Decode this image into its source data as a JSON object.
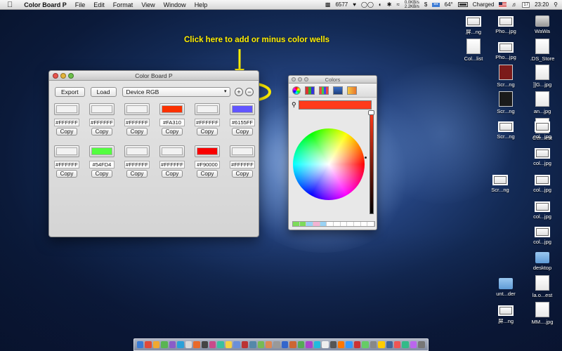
{
  "menubar": {
    "apple": "",
    "app_name": "Color Board P",
    "menus": [
      "File",
      "Edit",
      "Format",
      "View",
      "Window",
      "Help"
    ],
    "status": {
      "count": "6577",
      "network_up": "0.0KB/s",
      "network_down": "2.2KB/s",
      "temperature": "64°",
      "battery": "Charged",
      "calendar_day": "17",
      "time": "23:20"
    }
  },
  "annotation": {
    "text": "Click here to add or minus color wells",
    "color": "#FFEE00"
  },
  "color_board": {
    "title": "Color Board P",
    "export_label": "Export",
    "load_label": "Load",
    "colorspace": "Device RGB",
    "add_label": "+",
    "minus_label": "−",
    "wells_row1": [
      {
        "hex": "#FFFFFF",
        "color": "#F2F2F2",
        "copy": "Copy"
      },
      {
        "hex": "#FFFFFF",
        "color": "#F2F2F2",
        "copy": "Copy"
      },
      {
        "hex": "#FFFFFF",
        "color": "#F2F2F2",
        "copy": "Copy"
      },
      {
        "hex": "#FA310",
        "color": "#FA3100",
        "copy": "Copy"
      },
      {
        "hex": "#FFFFFF",
        "color": "#F2F2F2",
        "copy": "Copy"
      },
      {
        "hex": "#6155FF",
        "color": "#6155FF",
        "copy": "Copy"
      }
    ],
    "wells_row2": [
      {
        "hex": "#FFFFFF",
        "color": "#F2F2F2",
        "copy": "Copy"
      },
      {
        "hex": "#54FD4",
        "color": "#54FD40",
        "copy": "Copy"
      },
      {
        "hex": "#FFFFFF",
        "color": "#F2F2F2",
        "copy": "Copy"
      },
      {
        "hex": "#FFFFFF",
        "color": "#F2F2F2",
        "copy": "Copy"
      },
      {
        "hex": "#F90000",
        "color": "#F90000",
        "copy": "Copy"
      },
      {
        "hex": "#FFFFFF",
        "color": "#F2F2F2",
        "copy": "Copy"
      }
    ]
  },
  "colors_panel": {
    "title": "Colors",
    "current_color": "#FF3A1A",
    "mode_icons": [
      "color-wheel-icon",
      "color-sliders-icon",
      "color-palettes-icon",
      "image-palettes-icon",
      "crayons-icon"
    ]
  },
  "desktop_icons": [
    {
      "label": "屏...ng"
    },
    {
      "label": "Pho...jpg"
    },
    {
      "label": "WaWa"
    },
    {
      "label": "Col...list"
    },
    {
      "label": "Pho...jpg"
    },
    {
      "label": ".DS_Store"
    },
    {
      "label": "Scr...ng"
    },
    {
      "label": "]]G...jpg"
    },
    {
      "label": "Scr...ng"
    },
    {
      "label": "an...jpg"
    },
    {
      "label": "Scr...ng"
    },
    {
      "label": "Cer...est"
    },
    {
      "label": "col...jpg"
    },
    {
      "label": "col...jpg"
    },
    {
      "label": "Scr...ng"
    },
    {
      "label": "col...jpg"
    },
    {
      "label": "col...jpg"
    },
    {
      "label": "col...jpg"
    },
    {
      "label": "desktop"
    },
    {
      "label": "unt...der"
    },
    {
      "label": "la.o...est"
    },
    {
      "label": "屏...ng"
    },
    {
      "label": "MM....jpg"
    }
  ]
}
